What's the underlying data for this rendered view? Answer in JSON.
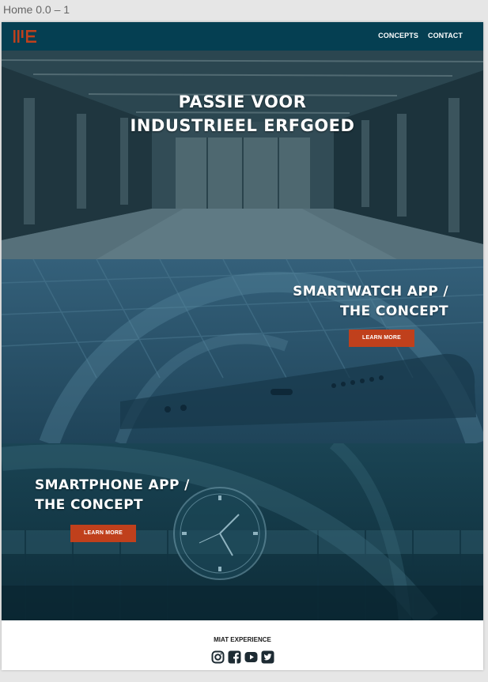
{
  "artboard": {
    "title": "Home 0.0 – 1"
  },
  "nav": {
    "logo": "ME",
    "links": [
      "CONCEPTS",
      "CONTACT"
    ]
  },
  "hero": {
    "title_line1": "PASSIE VOOR",
    "title_line2": "INDUSTRIEEL ERFGOED"
  },
  "sections": [
    {
      "title_line1": "SMARTWATCH APP /",
      "title_line2": "THE CONCEPT",
      "button": "LEARN MORE"
    },
    {
      "title_line1": "SMARTPHONE APP /",
      "title_line2": "THE CONCEPT",
      "button": "LEARN MORE"
    }
  ],
  "footer": {
    "brand": "MIAT EXPERIENCE",
    "social_icons": [
      "instagram-icon",
      "facebook-icon",
      "youtube-icon",
      "twitter-icon"
    ]
  },
  "colors": {
    "nav_bg": "#053f52",
    "accent": "#c0401c",
    "watch_section": "#2a5067",
    "phone_section": "#143d4d"
  }
}
